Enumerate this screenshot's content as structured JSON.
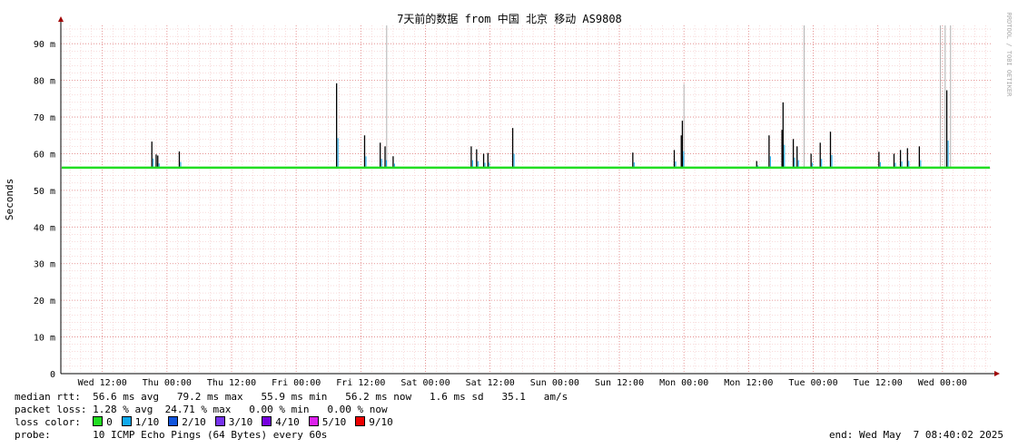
{
  "chart_data": {
    "type": "line",
    "title": "7天前的数据 from 中国 北京 移动 AS9808",
    "ylabel": "Seconds",
    "watermark": "RRDTOOL / TOBI OETIKER",
    "y_ticks": [
      "0",
      "10 m",
      "20 m",
      "30 m",
      "40 m",
      "50 m",
      "60 m",
      "70 m",
      "80 m",
      "90 m"
    ],
    "y_values": [
      0,
      10,
      20,
      30,
      40,
      50,
      60,
      70,
      80,
      90
    ],
    "ylim": [
      0,
      95
    ],
    "x_ticks": [
      "Wed 12:00",
      "Thu 00:00",
      "Thu 12:00",
      "Fri 00:00",
      "Fri 12:00",
      "Sat 00:00",
      "Sat 12:00",
      "Sun 00:00",
      "Sun 12:00",
      "Mon 00:00",
      "Mon 12:00",
      "Tue 00:00",
      "Tue 12:00",
      "Wed 00:00"
    ],
    "x_tick_hours": [
      12,
      24,
      36,
      48,
      60,
      72,
      84,
      96,
      108,
      120,
      132,
      144,
      156,
      168
    ],
    "xlim_hours": [
      4.3,
      177.3
    ],
    "grid": true,
    "series": [
      {
        "name": "median rtt",
        "baseline": 56.2,
        "color": "#22dd22",
        "spikes": [
          {
            "x": 21.2,
            "y": 63.3
          },
          {
            "x": 22.0,
            "y": 59.8
          },
          {
            "x": 22.3,
            "y": 59.5
          },
          {
            "x": 26.3,
            "y": 60.6
          },
          {
            "x": 55.5,
            "y": 79.2
          },
          {
            "x": 60.7,
            "y": 65.0
          },
          {
            "x": 63.6,
            "y": 63.0
          },
          {
            "x": 64.5,
            "y": 62.0
          },
          {
            "x": 66.0,
            "y": 59.3
          },
          {
            "x": 80.5,
            "y": 62.0
          },
          {
            "x": 81.5,
            "y": 61.2
          },
          {
            "x": 82.8,
            "y": 60.0
          },
          {
            "x": 83.6,
            "y": 60.2
          },
          {
            "x": 88.2,
            "y": 67.0
          },
          {
            "x": 110.5,
            "y": 60.3
          },
          {
            "x": 118.2,
            "y": 61.0
          },
          {
            "x": 119.5,
            "y": 65.0
          },
          {
            "x": 119.7,
            "y": 69.0
          },
          {
            "x": 133.5,
            "y": 58.0
          },
          {
            "x": 135.8,
            "y": 65.0
          },
          {
            "x": 138.2,
            "y": 66.5
          },
          {
            "x": 138.4,
            "y": 74.0
          },
          {
            "x": 140.3,
            "y": 64.0
          },
          {
            "x": 141.0,
            "y": 62.0
          },
          {
            "x": 143.6,
            "y": 60.0
          },
          {
            "x": 145.3,
            "y": 63.0
          },
          {
            "x": 147.2,
            "y": 66.0
          },
          {
            "x": 156.2,
            "y": 60.5
          },
          {
            "x": 159.0,
            "y": 60.0
          },
          {
            "x": 160.2,
            "y": 61.0
          },
          {
            "x": 161.5,
            "y": 61.5
          },
          {
            "x": 163.7,
            "y": 62.0
          },
          {
            "x": 168.8,
            "y": 77.3
          }
        ],
        "outliers": [
          {
            "x": 64.8,
            "y": 95.0
          },
          {
            "x": 120.0,
            "y": 79.0
          },
          {
            "x": 142.3,
            "y": 95.0
          },
          {
            "x": 167.6,
            "y": 95.0
          },
          {
            "x": 168.5,
            "y": 95.0
          },
          {
            "x": 169.5,
            "y": 95.0
          }
        ]
      }
    ]
  },
  "legend": {
    "median_label": "median rtt:",
    "median_stats": "56.6 ms avg   79.2 ms max   55.9 ms min   56.2 ms now   1.6 ms sd   35.1   am/s",
    "loss_label": "packet loss:",
    "loss_stats": "1.28 % avg  24.71 % max   0.00 % min   0.00 % now",
    "color_label": "loss color:",
    "colors": [
      {
        "label": "0",
        "color": "#22dd22"
      },
      {
        "label": "1/10",
        "color": "#11aaee"
      },
      {
        "label": "2/10",
        "color": "#1155dd"
      },
      {
        "label": "3/10",
        "color": "#7733ee"
      },
      {
        "label": "4/10",
        "color": "#7700dd"
      },
      {
        "label": "5/10",
        "color": "#dd22ee"
      },
      {
        "label": "9/10",
        "color": "#ee0000"
      }
    ],
    "probe_label": "probe:",
    "probe_text": "10 ICMP Echo Pings (64 Bytes) every 60s",
    "end_text": "end: Wed May  7 08:40:02 2025"
  }
}
